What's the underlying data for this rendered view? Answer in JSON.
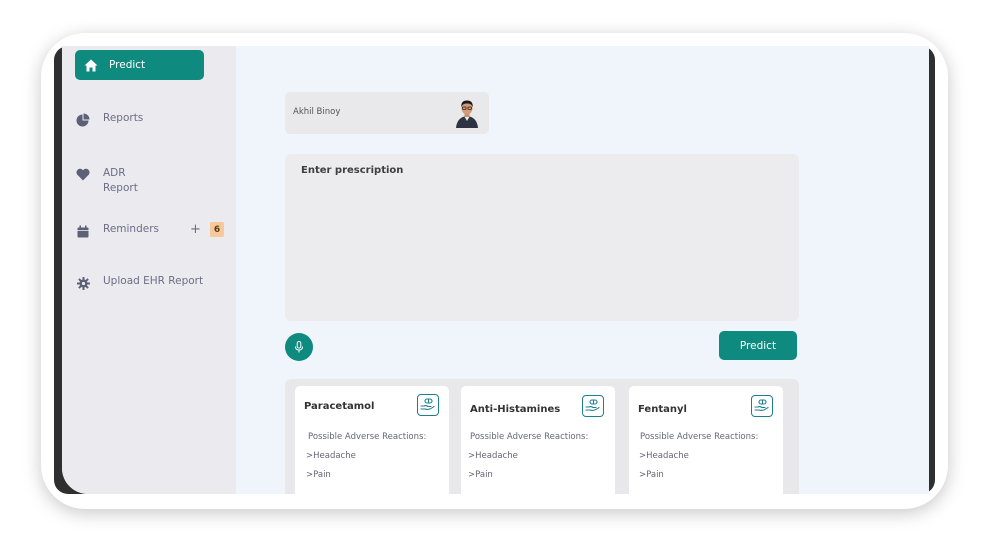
{
  "sidebar": {
    "items": [
      {
        "label": "Predict",
        "icon": "home-icon"
      },
      {
        "label": "Reports",
        "icon": "pie-chart-icon"
      },
      {
        "label_line1": "ADR",
        "label_line2": "Report",
        "icon": "heart-icon"
      },
      {
        "label": "Reminders",
        "icon": "calendar-icon",
        "plus": "+",
        "badge": "6"
      },
      {
        "label": "Upload EHR Report",
        "icon": "gear-icon"
      }
    ]
  },
  "user": {
    "name": "Akhil Binoy"
  },
  "prescription": {
    "label": "Enter prescription",
    "value": ""
  },
  "actions": {
    "predict_label": "Predict"
  },
  "results": [
    {
      "drug": "Paracetamol",
      "reactions_label": "Possible Adverse Reactions:",
      "reactions": [
        ">Headache",
        ">Pain"
      ]
    },
    {
      "drug": "Anti-Histamines",
      "reactions_label": "Possible Adverse Reactions:",
      "reactions": [
        ">Headache",
        ">Pain"
      ]
    },
    {
      "drug": "Fentanyl",
      "reactions_label": "Possible Adverse Reactions:",
      "reactions": [
        ">Headache",
        ">Pain"
      ]
    }
  ],
  "colors": {
    "accent": "#0f8a7f",
    "sidebar_bg": "#ebebef",
    "main_bg": "#f0f5fc",
    "badge": "#f6c89a"
  }
}
